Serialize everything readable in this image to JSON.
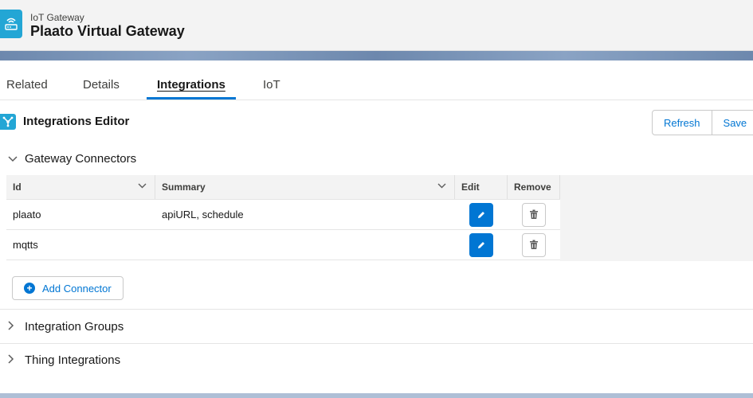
{
  "header": {
    "subtitle": "IoT Gateway",
    "title": "Plaato Virtual Gateway",
    "icon": "router-icon"
  },
  "tabs": [
    {
      "label": "Related",
      "active": false
    },
    {
      "label": "Details",
      "active": false
    },
    {
      "label": "Integrations",
      "active": true
    },
    {
      "label": "IoT",
      "active": false
    }
  ],
  "editor": {
    "title": "Integrations Editor",
    "icon": "integrations-icon",
    "refresh_label": "Refresh",
    "save_label": "Save"
  },
  "gateway_connectors": {
    "title": "Gateway Connectors",
    "expanded": true,
    "columns": [
      "Id",
      "Summary",
      "Edit",
      "Remove"
    ],
    "rows": [
      {
        "id": "plaato",
        "summary": "apiURL, schedule"
      },
      {
        "id": "mqtts",
        "summary": ""
      }
    ],
    "add_label": "Add Connector"
  },
  "integration_groups": {
    "title": "Integration Groups",
    "expanded": false
  },
  "thing_integrations": {
    "title": "Thing Integrations",
    "expanded": false
  },
  "colors": {
    "brand_blue": "#0176d3",
    "icon_teal": "#23a6d5"
  }
}
